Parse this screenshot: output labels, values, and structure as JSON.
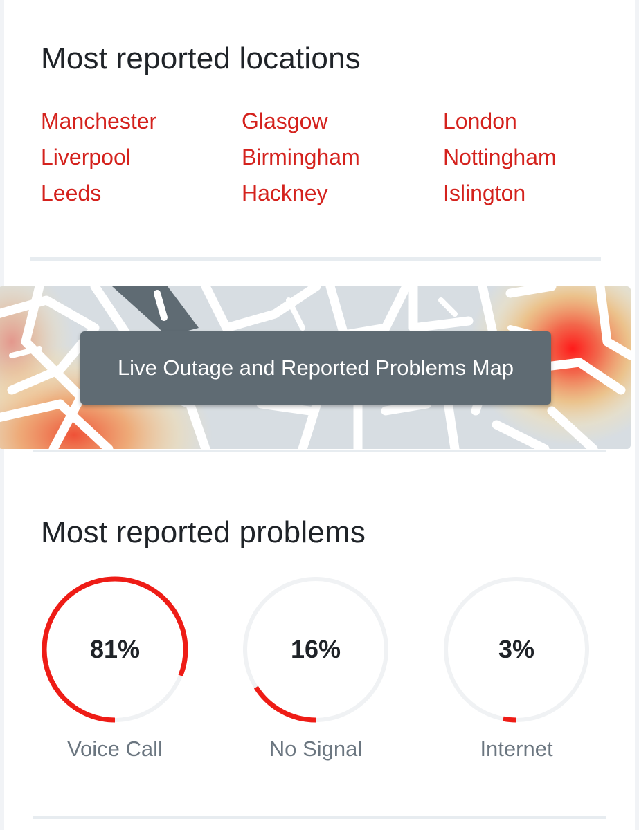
{
  "locations": {
    "title": "Most reported locations",
    "items": [
      "Manchester",
      "Glasgow",
      "London",
      "Liverpool",
      "Birmingham",
      "Nottingham",
      "Leeds",
      "Hackney",
      "Islington"
    ]
  },
  "map": {
    "button_label": "Live Outage and Reported Problems Map"
  },
  "problems": {
    "title": "Most reported problems",
    "items": [
      {
        "label": "Voice Call",
        "percent_text": "81%",
        "value": 81
      },
      {
        "label": "No Signal",
        "percent_text": "16%",
        "value": 16
      },
      {
        "label": "Internet",
        "percent_text": "3%",
        "value": 3
      }
    ]
  },
  "colors": {
    "accent_red": "#ee1c16",
    "link_red": "#d4221d",
    "track_gray": "#f0f2f4",
    "map_button": "#5f6b73"
  }
}
